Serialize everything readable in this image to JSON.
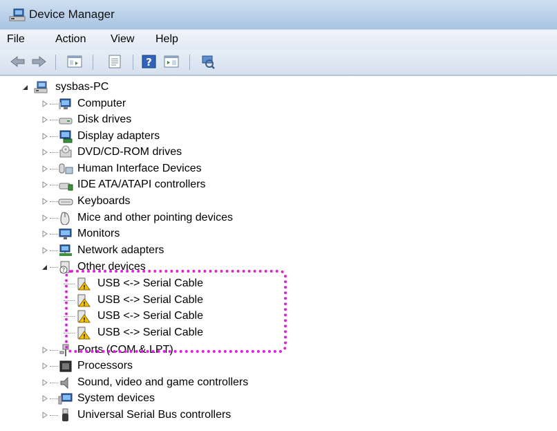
{
  "window": {
    "title": "Device Manager"
  },
  "menu": {
    "items": [
      "File",
      "Action",
      "View",
      "Help"
    ]
  },
  "tree": {
    "root": "sysbas-PC",
    "categories": [
      {
        "label": "Computer",
        "icon": "computer-icon"
      },
      {
        "label": "Disk drives",
        "icon": "disk-drive-icon"
      },
      {
        "label": "Display adapters",
        "icon": "display-adapter-icon"
      },
      {
        "label": "DVD/CD-ROM drives",
        "icon": "dvd-drive-icon"
      },
      {
        "label": "Human Interface Devices",
        "icon": "hid-icon"
      },
      {
        "label": "IDE ATA/ATAPI controllers",
        "icon": "ide-controller-icon"
      },
      {
        "label": "Keyboards",
        "icon": "keyboard-icon"
      },
      {
        "label": "Mice and other pointing devices",
        "icon": "mouse-icon"
      },
      {
        "label": "Monitors",
        "icon": "monitor-icon"
      },
      {
        "label": "Network adapters",
        "icon": "network-adapter-icon"
      },
      {
        "label": "Other devices",
        "icon": "other-devices-icon",
        "expanded": true,
        "children": [
          "USB <-> Serial Cable",
          "USB <-> Serial Cable",
          "USB <-> Serial Cable",
          "USB <-> Serial Cable"
        ]
      },
      {
        "label": "Ports (COM & LPT)",
        "icon": "port-icon"
      },
      {
        "label": "Processors",
        "icon": "processor-icon"
      },
      {
        "label": "Sound, video and game controllers",
        "icon": "speaker-icon"
      },
      {
        "label": "System devices",
        "icon": "system-device-icon"
      },
      {
        "label": "Universal Serial Bus controllers",
        "icon": "usb-icon"
      }
    ]
  },
  "colors": {
    "highlight": "#e020d8",
    "warning": "#f2c200"
  }
}
